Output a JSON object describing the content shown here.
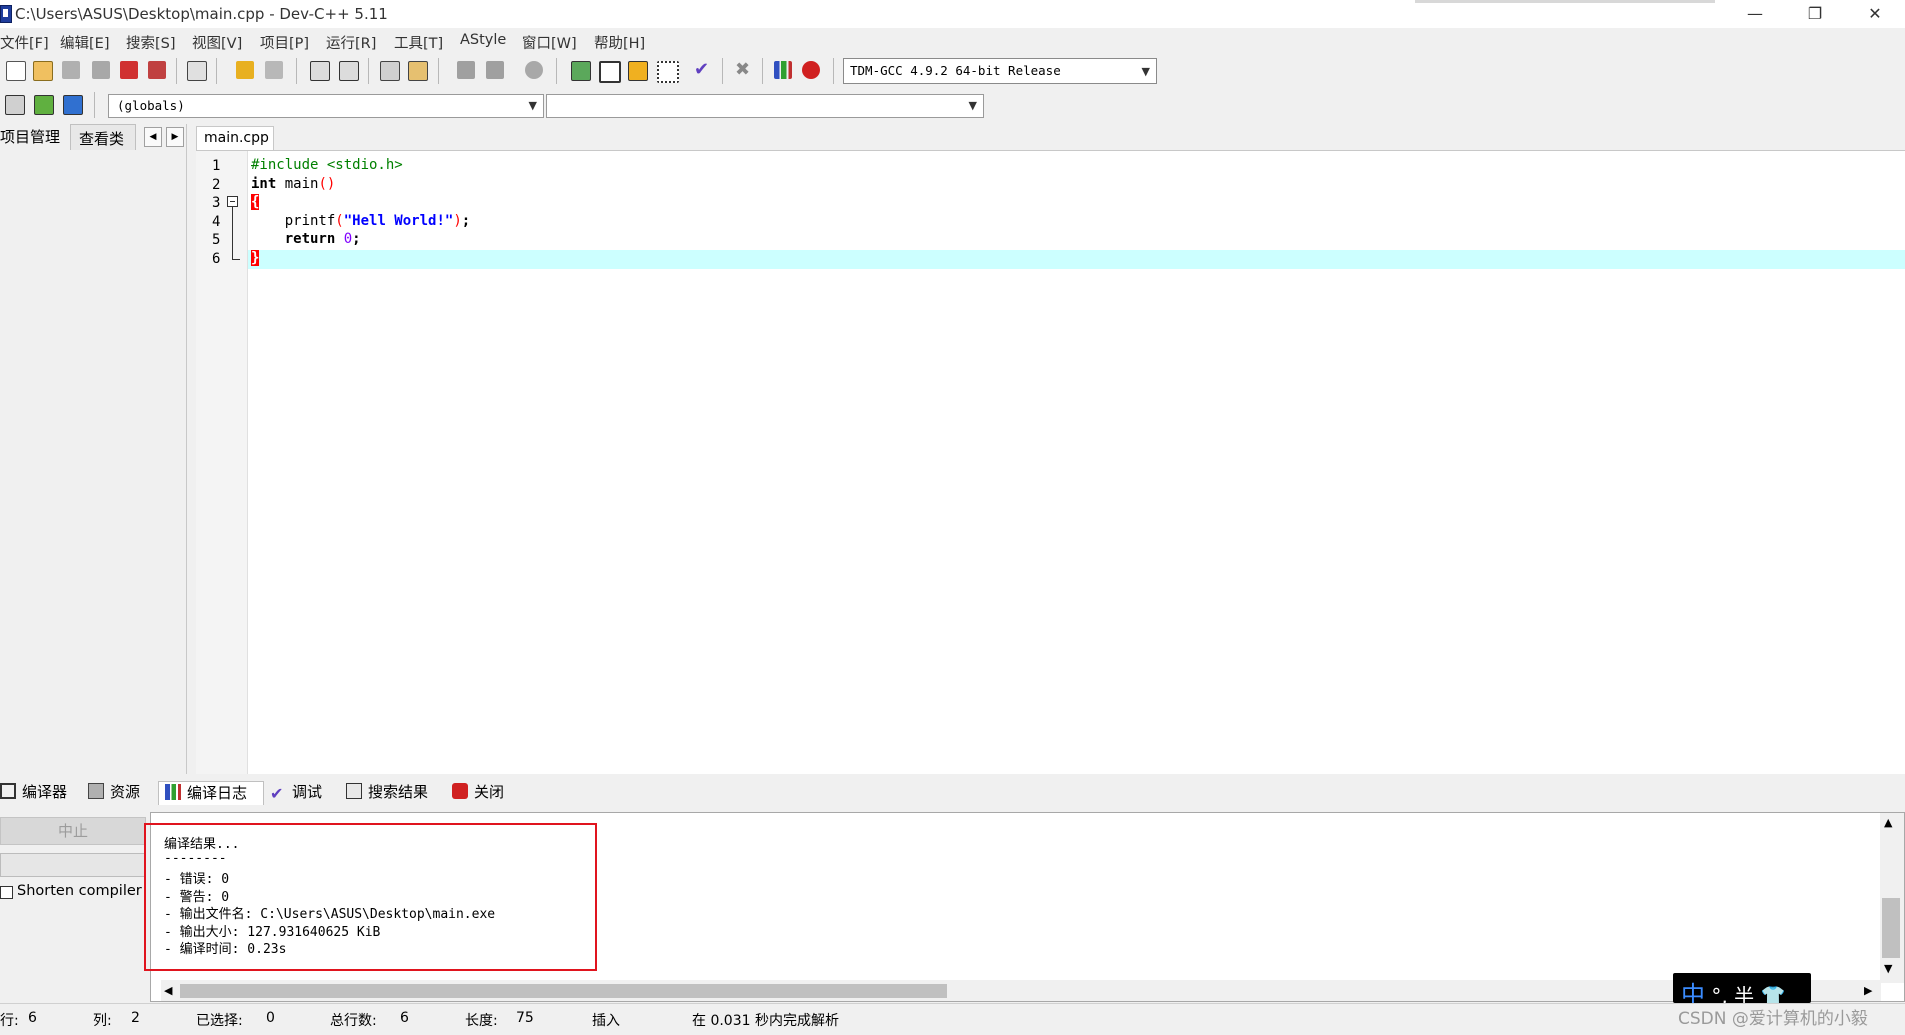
{
  "window": {
    "title": "C:\\Users\\ASUS\\Desktop\\main.cpp - Dev-C++ 5.11",
    "minimize": "—",
    "restore": "❐",
    "close": "✕"
  },
  "menu": [
    "文件[F]",
    "编辑[E]",
    "搜索[S]",
    "视图[V]",
    "项目[P]",
    "运行[R]",
    "工具[T]",
    "AStyle",
    "窗口[W]",
    "帮助[H]"
  ],
  "toolbar": {
    "compiler": "TDM-GCC 4.9.2 64-bit Release",
    "scope": "(globals)",
    "members": "",
    "icons": [
      "new-file-icon",
      "open-file-icon",
      "save-icon",
      "save-all-icon",
      "close-file-icon",
      "close-all-icon",
      "print-icon",
      "undo-icon",
      "redo-icon",
      "find-icon",
      "replace-icon",
      "goto-line-icon",
      "bookmark-icon",
      "indent-icon",
      "unindent-icon",
      "toggle-comment-icon",
      "project-new-icon",
      "window-icon",
      "fullscreen-icon",
      "grid-icon",
      "check-syntax-icon",
      "delete-icon",
      "chart-icon",
      "debug-icon"
    ]
  },
  "left_panel": {
    "tabs": [
      "项目管理",
      "查看类"
    ],
    "left_arrow": "◀",
    "right_arrow": "▶"
  },
  "editor": {
    "tab_label": "main.cpp",
    "line_numbers": [
      "1",
      "2",
      "3",
      "4",
      "5",
      "6"
    ],
    "lines": {
      "l1_directive": "#include <stdio.h>",
      "l2_type": "int",
      "l2_name": " main",
      "l2_parens": "()",
      "l3_brace": "{",
      "l4_indent": "    ",
      "l4_func": "printf",
      "l4_open": "(",
      "l4_string": "\"Hell World!\"",
      "l4_close": ")",
      "l4_semicolon": ";",
      "l5_indent": "    ",
      "l5_keyword": "return",
      "l5_space": " ",
      "l5_value": "0",
      "l5_semicolon": ";",
      "l6_brace": "}"
    }
  },
  "bottom_tabs": [
    "编译器",
    "资源",
    "编译日志",
    "调试",
    "搜索结果",
    "关闭"
  ],
  "bottom_panel": {
    "abort_button": "中止",
    "shorten_label": "Shorten compiler paths",
    "log": [
      "编译结果...",
      "--------",
      "- 错误: 0",
      "- 警告: 0",
      "- 输出文件名: C:\\Users\\ASUS\\Desktop\\main.exe",
      "- 输出大小: 127.931640625 KiB",
      "- 编译时间: 0.23s"
    ],
    "scroll_up": "▲",
    "scroll_down": "▼",
    "scroll_left": "◀",
    "scroll_right": "▶"
  },
  "ime": {
    "mode": "中",
    "punct": "°,",
    "width": "半",
    "skin": "👕"
  },
  "statusbar": {
    "row_label": "行:",
    "row_value": "6",
    "col_label": "列:",
    "col_value": "2",
    "sel_label": "已选择:",
    "sel_value": "0",
    "total_label": "总行数:",
    "total_value": "6",
    "len_label": "长度:",
    "len_value": "75",
    "mode": "插入",
    "parse_msg": "在 0.031 秒内完成解析"
  },
  "watermark": "CSDN @爱计算机的小毅",
  "colors": {
    "current_line": "#ccffff",
    "brace_match": "#ff0000",
    "preprocessor": "#008000",
    "string": "#0000ff",
    "number": "#8000ff",
    "highlight_box": "#e0141e"
  }
}
